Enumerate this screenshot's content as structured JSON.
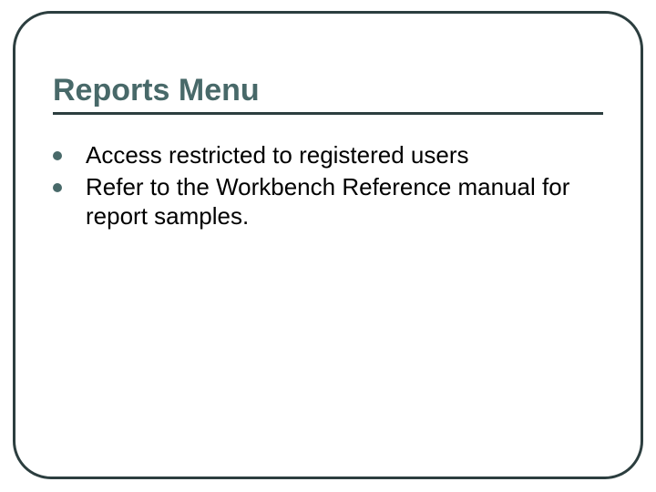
{
  "slide": {
    "title": "Reports Menu",
    "bullets": [
      "Access restricted to registered users",
      "Refer to the Workbench Reference manual for report samples."
    ]
  }
}
